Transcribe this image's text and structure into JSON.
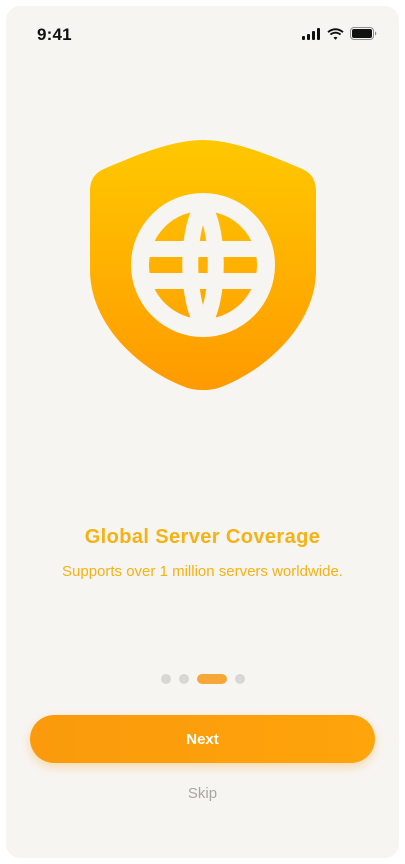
{
  "status_bar": {
    "time": "9:41",
    "icons": [
      "signal-icon",
      "wifi-icon",
      "battery-icon"
    ]
  },
  "illustration": {
    "icon": "shield-globe-icon",
    "gradient_top": "#ffc800",
    "gradient_bottom": "#ff9a00",
    "globe_color": "#f7f5f2"
  },
  "onboarding": {
    "title": "Global Server Coverage",
    "subtitle": "Supports over 1 million servers worldwide.",
    "accent_color": "#f4b214"
  },
  "pagination": {
    "total": 4,
    "current": 3
  },
  "actions": {
    "next_label": "Next",
    "skip_label": "Skip",
    "button_color": "#fa9a0c"
  }
}
